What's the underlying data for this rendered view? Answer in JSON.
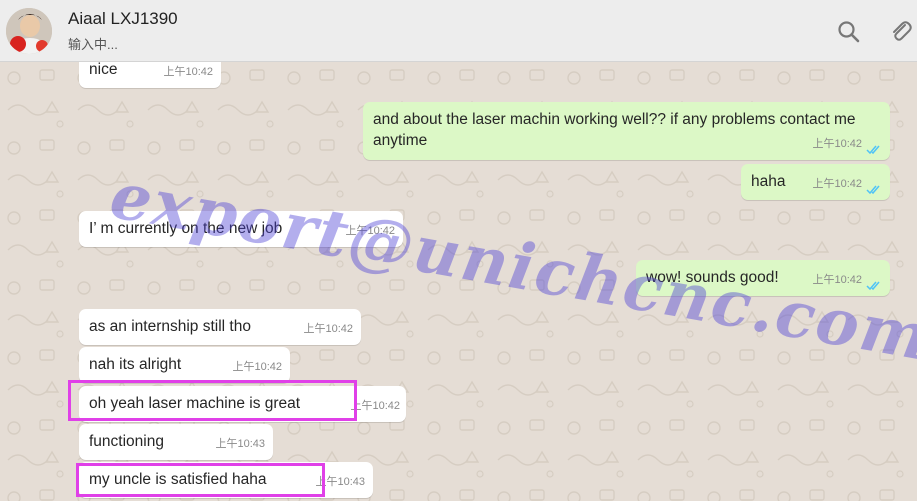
{
  "header": {
    "contact_name": "Aiaal LXJ1390",
    "status": "输入中..."
  },
  "messages": [
    {
      "text": "nice",
      "time": "上午10:42",
      "side": "in"
    },
    {
      "text": "and about the laser machin working well?? if any problems contact me anytime",
      "time": "上午10:42",
      "side": "out",
      "read": true
    },
    {
      "text": "haha",
      "time": "上午10:42",
      "side": "out",
      "read": true
    },
    {
      "text": "I’ m currently on the new job",
      "time": "上午10:42",
      "side": "in"
    },
    {
      "text": "wow! sounds good!",
      "time": "上午10:42",
      "side": "out",
      "read": true
    },
    {
      "text": "as an internship still tho",
      "time": "上午10:42",
      "side": "in"
    },
    {
      "text": "nah its alright",
      "time": "上午10:42",
      "side": "in"
    },
    {
      "text": "oh yeah laser machine is great",
      "time": "上午10:42",
      "side": "in",
      "highlighted": true
    },
    {
      "text": "functioning",
      "time": "上午10:43",
      "side": "in"
    },
    {
      "text": "my uncle is satisfied haha",
      "time": "上午10:43",
      "side": "in",
      "highlighted": true
    }
  ],
  "watermark": "export@unichcnc.com",
  "colors": {
    "outgoing_bubble": "#dcf8c6",
    "incoming_bubble": "#ffffff",
    "chat_background": "#e5ddd5",
    "read_ticks": "#4fc3f7",
    "highlight_box": "#e040e8"
  },
  "icons": [
    "search-icon",
    "attach-icon",
    "double-check-icon"
  ]
}
